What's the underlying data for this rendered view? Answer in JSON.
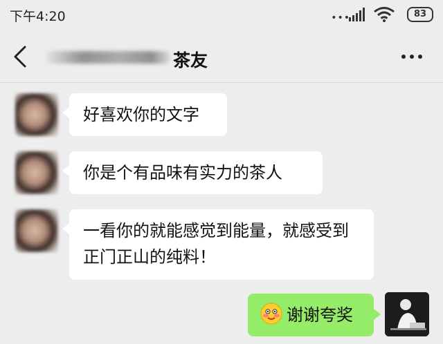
{
  "status_bar": {
    "time": "下午4:20",
    "indicator_dots": "•••",
    "battery": "83"
  },
  "header": {
    "contact_name": "茶友"
  },
  "messages": [
    {
      "side": "left",
      "text": "好喜欢你的文字"
    },
    {
      "side": "left",
      "text": "你是个有品味有实力的茶人"
    },
    {
      "side": "left",
      "text": "一看你的就能感觉到能量，就感受到正门正山的纯料！"
    },
    {
      "side": "right",
      "emoji": "flushed-smile-icon",
      "text": "谢谢夸奖"
    }
  ],
  "colors": {
    "background": "#ededed",
    "incoming_bubble": "#ffffff",
    "outgoing_bubble": "#95ec69"
  }
}
